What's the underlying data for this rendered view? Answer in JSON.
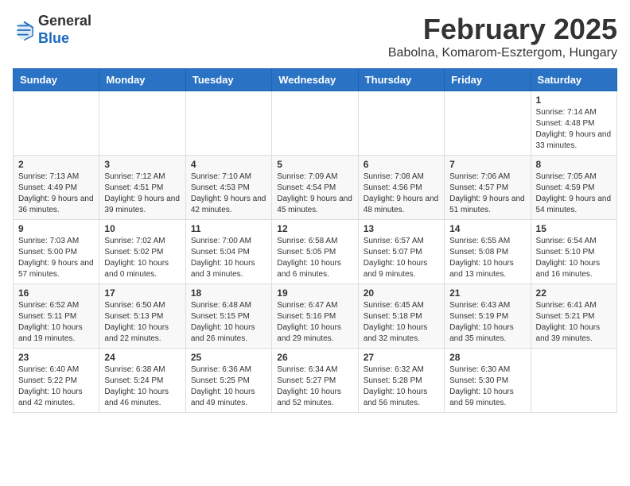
{
  "logo": {
    "general": "General",
    "blue": "Blue"
  },
  "header": {
    "title": "February 2025",
    "subtitle": "Babolna, Komarom-Esztergom, Hungary"
  },
  "weekdays": [
    "Sunday",
    "Monday",
    "Tuesday",
    "Wednesday",
    "Thursday",
    "Friday",
    "Saturday"
  ],
  "weeks": [
    [
      {
        "day": "",
        "info": ""
      },
      {
        "day": "",
        "info": ""
      },
      {
        "day": "",
        "info": ""
      },
      {
        "day": "",
        "info": ""
      },
      {
        "day": "",
        "info": ""
      },
      {
        "day": "",
        "info": ""
      },
      {
        "day": "1",
        "info": "Sunrise: 7:14 AM\nSunset: 4:48 PM\nDaylight: 9 hours and 33 minutes."
      }
    ],
    [
      {
        "day": "2",
        "info": "Sunrise: 7:13 AM\nSunset: 4:49 PM\nDaylight: 9 hours and 36 minutes."
      },
      {
        "day": "3",
        "info": "Sunrise: 7:12 AM\nSunset: 4:51 PM\nDaylight: 9 hours and 39 minutes."
      },
      {
        "day": "4",
        "info": "Sunrise: 7:10 AM\nSunset: 4:53 PM\nDaylight: 9 hours and 42 minutes."
      },
      {
        "day": "5",
        "info": "Sunrise: 7:09 AM\nSunset: 4:54 PM\nDaylight: 9 hours and 45 minutes."
      },
      {
        "day": "6",
        "info": "Sunrise: 7:08 AM\nSunset: 4:56 PM\nDaylight: 9 hours and 48 minutes."
      },
      {
        "day": "7",
        "info": "Sunrise: 7:06 AM\nSunset: 4:57 PM\nDaylight: 9 hours and 51 minutes."
      },
      {
        "day": "8",
        "info": "Sunrise: 7:05 AM\nSunset: 4:59 PM\nDaylight: 9 hours and 54 minutes."
      }
    ],
    [
      {
        "day": "9",
        "info": "Sunrise: 7:03 AM\nSunset: 5:00 PM\nDaylight: 9 hours and 57 minutes."
      },
      {
        "day": "10",
        "info": "Sunrise: 7:02 AM\nSunset: 5:02 PM\nDaylight: 10 hours and 0 minutes."
      },
      {
        "day": "11",
        "info": "Sunrise: 7:00 AM\nSunset: 5:04 PM\nDaylight: 10 hours and 3 minutes."
      },
      {
        "day": "12",
        "info": "Sunrise: 6:58 AM\nSunset: 5:05 PM\nDaylight: 10 hours and 6 minutes."
      },
      {
        "day": "13",
        "info": "Sunrise: 6:57 AM\nSunset: 5:07 PM\nDaylight: 10 hours and 9 minutes."
      },
      {
        "day": "14",
        "info": "Sunrise: 6:55 AM\nSunset: 5:08 PM\nDaylight: 10 hours and 13 minutes."
      },
      {
        "day": "15",
        "info": "Sunrise: 6:54 AM\nSunset: 5:10 PM\nDaylight: 10 hours and 16 minutes."
      }
    ],
    [
      {
        "day": "16",
        "info": "Sunrise: 6:52 AM\nSunset: 5:11 PM\nDaylight: 10 hours and 19 minutes."
      },
      {
        "day": "17",
        "info": "Sunrise: 6:50 AM\nSunset: 5:13 PM\nDaylight: 10 hours and 22 minutes."
      },
      {
        "day": "18",
        "info": "Sunrise: 6:48 AM\nSunset: 5:15 PM\nDaylight: 10 hours and 26 minutes."
      },
      {
        "day": "19",
        "info": "Sunrise: 6:47 AM\nSunset: 5:16 PM\nDaylight: 10 hours and 29 minutes."
      },
      {
        "day": "20",
        "info": "Sunrise: 6:45 AM\nSunset: 5:18 PM\nDaylight: 10 hours and 32 minutes."
      },
      {
        "day": "21",
        "info": "Sunrise: 6:43 AM\nSunset: 5:19 PM\nDaylight: 10 hours and 35 minutes."
      },
      {
        "day": "22",
        "info": "Sunrise: 6:41 AM\nSunset: 5:21 PM\nDaylight: 10 hours and 39 minutes."
      }
    ],
    [
      {
        "day": "23",
        "info": "Sunrise: 6:40 AM\nSunset: 5:22 PM\nDaylight: 10 hours and 42 minutes."
      },
      {
        "day": "24",
        "info": "Sunrise: 6:38 AM\nSunset: 5:24 PM\nDaylight: 10 hours and 46 minutes."
      },
      {
        "day": "25",
        "info": "Sunrise: 6:36 AM\nSunset: 5:25 PM\nDaylight: 10 hours and 49 minutes."
      },
      {
        "day": "26",
        "info": "Sunrise: 6:34 AM\nSunset: 5:27 PM\nDaylight: 10 hours and 52 minutes."
      },
      {
        "day": "27",
        "info": "Sunrise: 6:32 AM\nSunset: 5:28 PM\nDaylight: 10 hours and 56 minutes."
      },
      {
        "day": "28",
        "info": "Sunrise: 6:30 AM\nSunset: 5:30 PM\nDaylight: 10 hours and 59 minutes."
      },
      {
        "day": "",
        "info": ""
      }
    ]
  ]
}
